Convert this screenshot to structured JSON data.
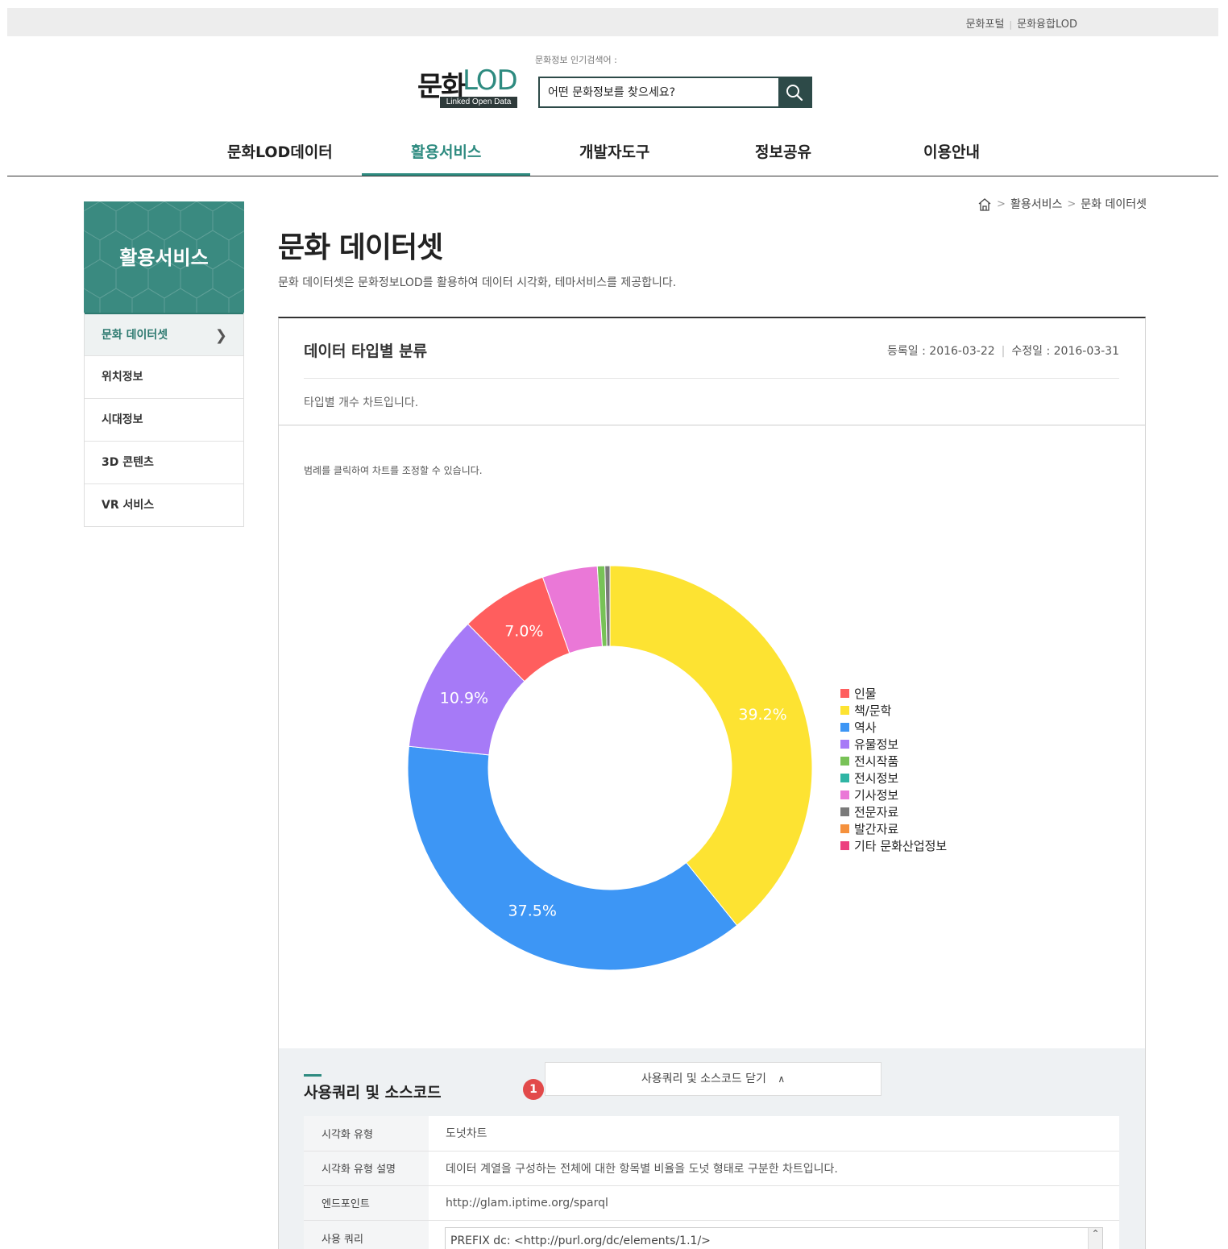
{
  "util_links": [
    "문화포털",
    "문화융합LOD"
  ],
  "logo": {
    "mun": "문화",
    "lod": "LOD",
    "sub": "Linked Open Data"
  },
  "search": {
    "popular_label": "문화정보 인기검색어 :",
    "placeholder": "어떤 문화정보를 찾으세요?"
  },
  "gnb": [
    "문화LOD데이터",
    "활용서비스",
    "개발자도구",
    "정보공유",
    "이용안내"
  ],
  "lnb": {
    "title": "활용서비스",
    "items": [
      "문화 데이터셋",
      "위치정보",
      "시대정보",
      "3D 콘텐츠",
      "VR 서비스"
    ]
  },
  "breadcrumb": [
    "활용서비스",
    "문화 데이터셋"
  ],
  "page": {
    "title": "문화 데이터셋",
    "desc": "문화 데이터셋은 문화정보LOD를 활용하여 데이터 시각화, 테마서비스를 제공합니다."
  },
  "dataset": {
    "name": "데이터 타입별 분류",
    "reg_date": "등록일 : 2016-03-22",
    "mod_date": "수정일 : 2016-03-31",
    "desc": "타입별 개수 차트입니다.",
    "legend_hint": "범례를 클릭하여 차트를 조정할 수 있습니다."
  },
  "chart_data": {
    "type": "pie",
    "variant": "donut",
    "legend_position": "right",
    "series": [
      {
        "name": "인물",
        "value": 7.0,
        "color": "#ff5e5e",
        "label": "7.0%"
      },
      {
        "name": "책/문학",
        "value": 39.2,
        "color": "#fde332",
        "label": "39.2%"
      },
      {
        "name": "역사",
        "value": 37.5,
        "color": "#3d96f5",
        "label": "37.5%"
      },
      {
        "name": "유물정보",
        "value": 10.9,
        "color": "#a67af7",
        "label": "10.9%"
      },
      {
        "name": "전시작품",
        "value": 0.6,
        "color": "#78c257",
        "label": ""
      },
      {
        "name": "전시정보",
        "value": 0.0,
        "color": "#2fb5a4",
        "label": ""
      },
      {
        "name": "기사정보",
        "value": 4.4,
        "color": "#ea78d7",
        "label": ""
      },
      {
        "name": "전문자료",
        "value": 0.4,
        "color": "#7a7a7a",
        "label": ""
      },
      {
        "name": "발간자료",
        "value": 0.0,
        "color": "#f5913d",
        "label": ""
      },
      {
        "name": "기타 문화산업정보",
        "value": 0.0,
        "color": "#ec3f7f",
        "label": ""
      }
    ],
    "draw_order": [
      "책/문학",
      "역사",
      "유물정보",
      "인물",
      "기사정보",
      "전시작품",
      "전문자료"
    ]
  },
  "source": {
    "title": "사용쿼리 및 소스코드",
    "badge": "1",
    "toggle_label": "사용쿼리 및 소스코드 닫기",
    "rows": [
      {
        "th": "시각화 유형",
        "tv": "도넛차트"
      },
      {
        "th": "시각화 유형 설명",
        "tv": "데이터 계열을 구성하는 전체에 대한 항목별 비율을 도넛 형태로 구분한 차트입니다."
      },
      {
        "th": "엔드포인트",
        "tv": "http://glam.iptime.org/sparql"
      },
      {
        "th": "사용 쿼리",
        "tv": "PREFIX  dc:  <http://purl.org/dc/elements/1.1/>"
      }
    ]
  }
}
